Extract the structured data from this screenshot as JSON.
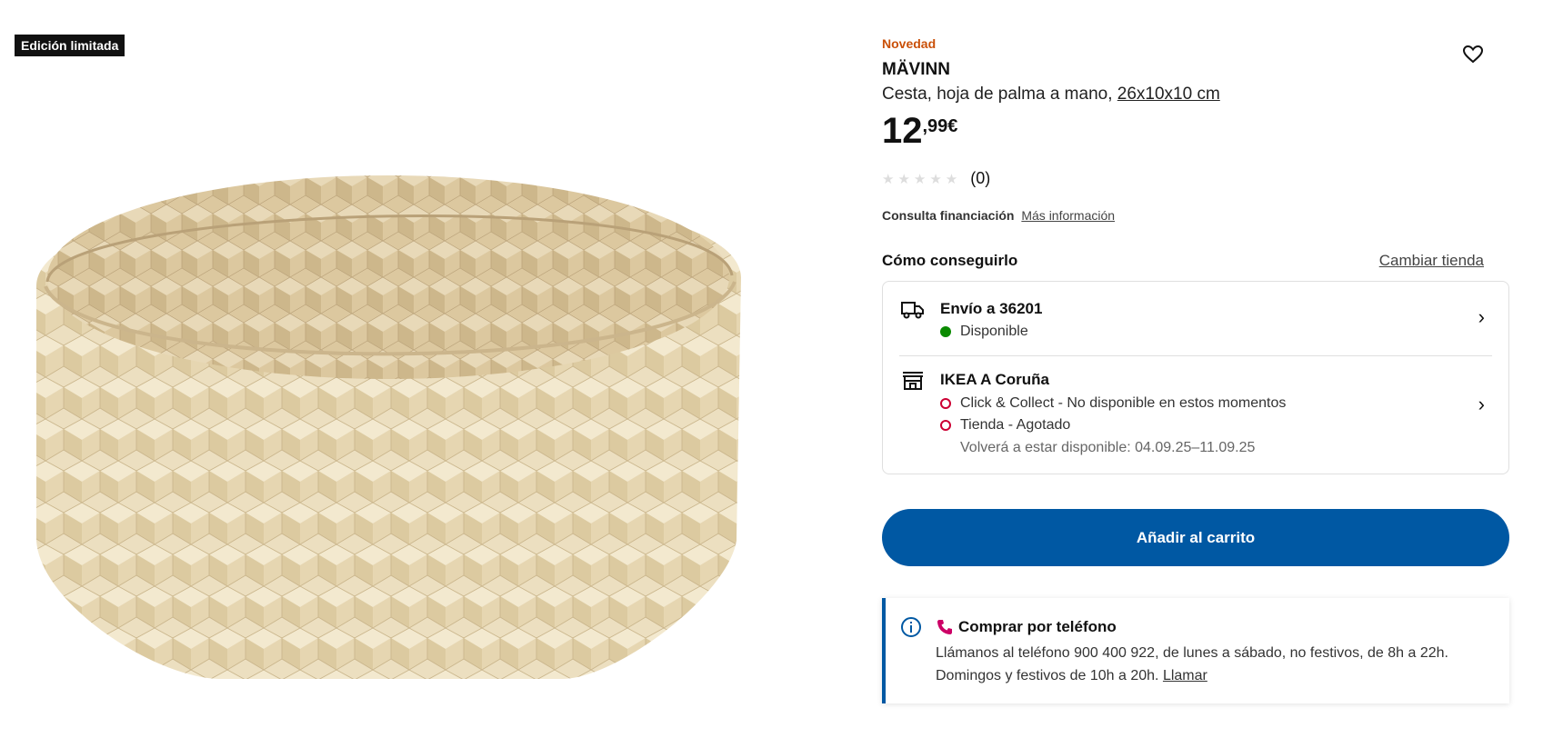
{
  "badge": "Edición limitada",
  "product": {
    "tag": "Novedad",
    "name": "MÄVINN",
    "description": "Cesta, hoja de palma a mano,",
    "size": "26x10x10 cm",
    "price_int": "12",
    "price_dec": ",99€",
    "rating_count": "(0)"
  },
  "financing": {
    "label": "Consulta financiación",
    "link": "Más información"
  },
  "availability": {
    "heading": "Cómo conseguirlo",
    "change_store": "Cambiar tienda",
    "delivery": {
      "title": "Envío a 36201",
      "status": "Disponible"
    },
    "store": {
      "title": "IKEA A Coruña",
      "click_collect": "Click & Collect - No disponible en estos momentos",
      "in_store": "Tienda - Agotado",
      "restock": "Volverá a estar disponible: 04.09.25–11.09.25"
    }
  },
  "cart_button": "Añadir al carrito",
  "phone_order": {
    "title": "Comprar por teléfono",
    "text": "Llámanos al teléfono 900 400 922, de lunes a sábado, no festivos, de 8h a 22h. Domingos y festivos de 10h a 20h.",
    "link": "Llamar"
  },
  "colors": {
    "accent": "#0058a3",
    "new": "#ca5008",
    "available": "#0a8a00",
    "unavailable": "#cc0033"
  }
}
